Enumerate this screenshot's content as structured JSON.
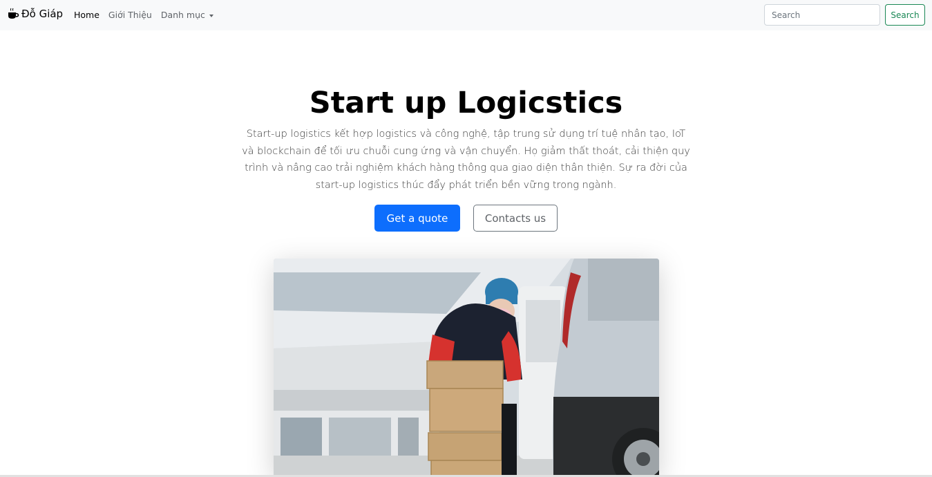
{
  "navbar": {
    "brand": "Đỗ Giáp",
    "brand_icon": "coffee-cup-icon",
    "links": [
      {
        "label": "Home",
        "active": true
      },
      {
        "label": "Giới Thiệu",
        "active": false
      }
    ],
    "dropdown_label": "Danh mục",
    "search_placeholder": "Search",
    "search_button": "Search"
  },
  "hero": {
    "title": "Start up Logicstics",
    "description": "Start-up logistics kết hợp logistics và công nghệ, tập trung sử dụng trí tuệ nhân tạo, IoT và blockchain để tối ưu chuỗi cung ứng và vận chuyển. Họ giảm thất thoát, cải thiện quy trình và nâng cao trải nghiệm khách hàng thông qua giao diện thân thiện. Sự ra đời của start-up logistics thúc đẩy phát triển bền vững trong ngành.",
    "primary_button": "Get a quote",
    "secondary_button": "Contacts us"
  },
  "colors": {
    "primary": "#0d6efd",
    "success": "#198754",
    "navbar_bg": "#f8f9fa"
  }
}
